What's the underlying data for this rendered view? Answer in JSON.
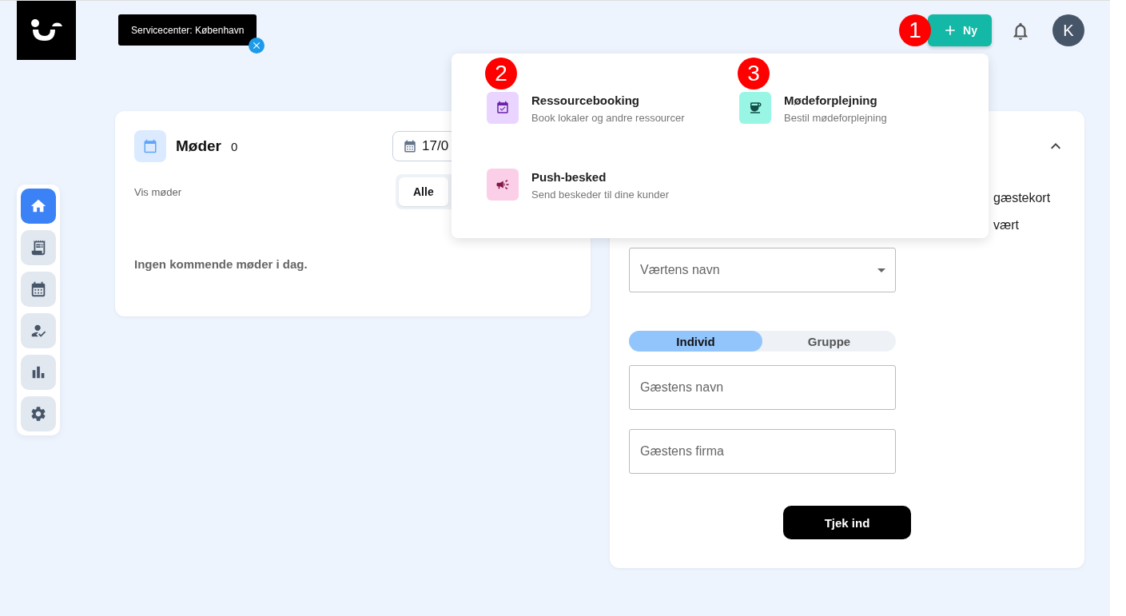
{
  "header": {
    "location_chip": {
      "label": "Servicecenter: København"
    },
    "new_button": {
      "label": "Ny",
      "marker": "1"
    },
    "avatar": {
      "initial": "K"
    }
  },
  "sidebar": {
    "items": [
      {
        "kind": "home",
        "selected": true
      },
      {
        "kind": "receipt",
        "selected": false
      },
      {
        "kind": "calendar",
        "selected": false
      },
      {
        "kind": "person",
        "selected": false
      },
      {
        "kind": "chart",
        "selected": false
      },
      {
        "kind": "settings",
        "selected": false
      }
    ]
  },
  "meetings_card": {
    "title": "Møder",
    "count": "0",
    "date": "17/0",
    "filter_label": "Vis møder",
    "filters": [
      {
        "label": "Alle",
        "selected": true
      }
    ],
    "empty_text": "Ingen kommende møder i dag."
  },
  "checkin_card": {
    "expanded": true,
    "options": [
      {
        "label": "gæstekort"
      },
      {
        "label": "vært"
      }
    ],
    "host_select": {
      "placeholder": "Værtens navn"
    },
    "segments": [
      {
        "label": "Individ",
        "selected": true
      },
      {
        "label": "Gruppe",
        "selected": false
      }
    ],
    "fields": [
      {
        "placeholder": "Gæstens navn"
      },
      {
        "placeholder": "Gæstens firma"
      }
    ],
    "submit": "Tjek ind"
  },
  "new_menu": {
    "items": [
      {
        "kind": "booking",
        "title": "Ressourcebooking",
        "description": "Book lokaler og andre ressourcer",
        "marker": "2"
      },
      {
        "kind": "catering",
        "title": "Mødeforplejning",
        "description": "Bestil mødeforplejning",
        "marker": "3"
      },
      {
        "kind": "push",
        "title": "Push-besked",
        "description": "Send beskeder til dine kunder"
      }
    ]
  }
}
